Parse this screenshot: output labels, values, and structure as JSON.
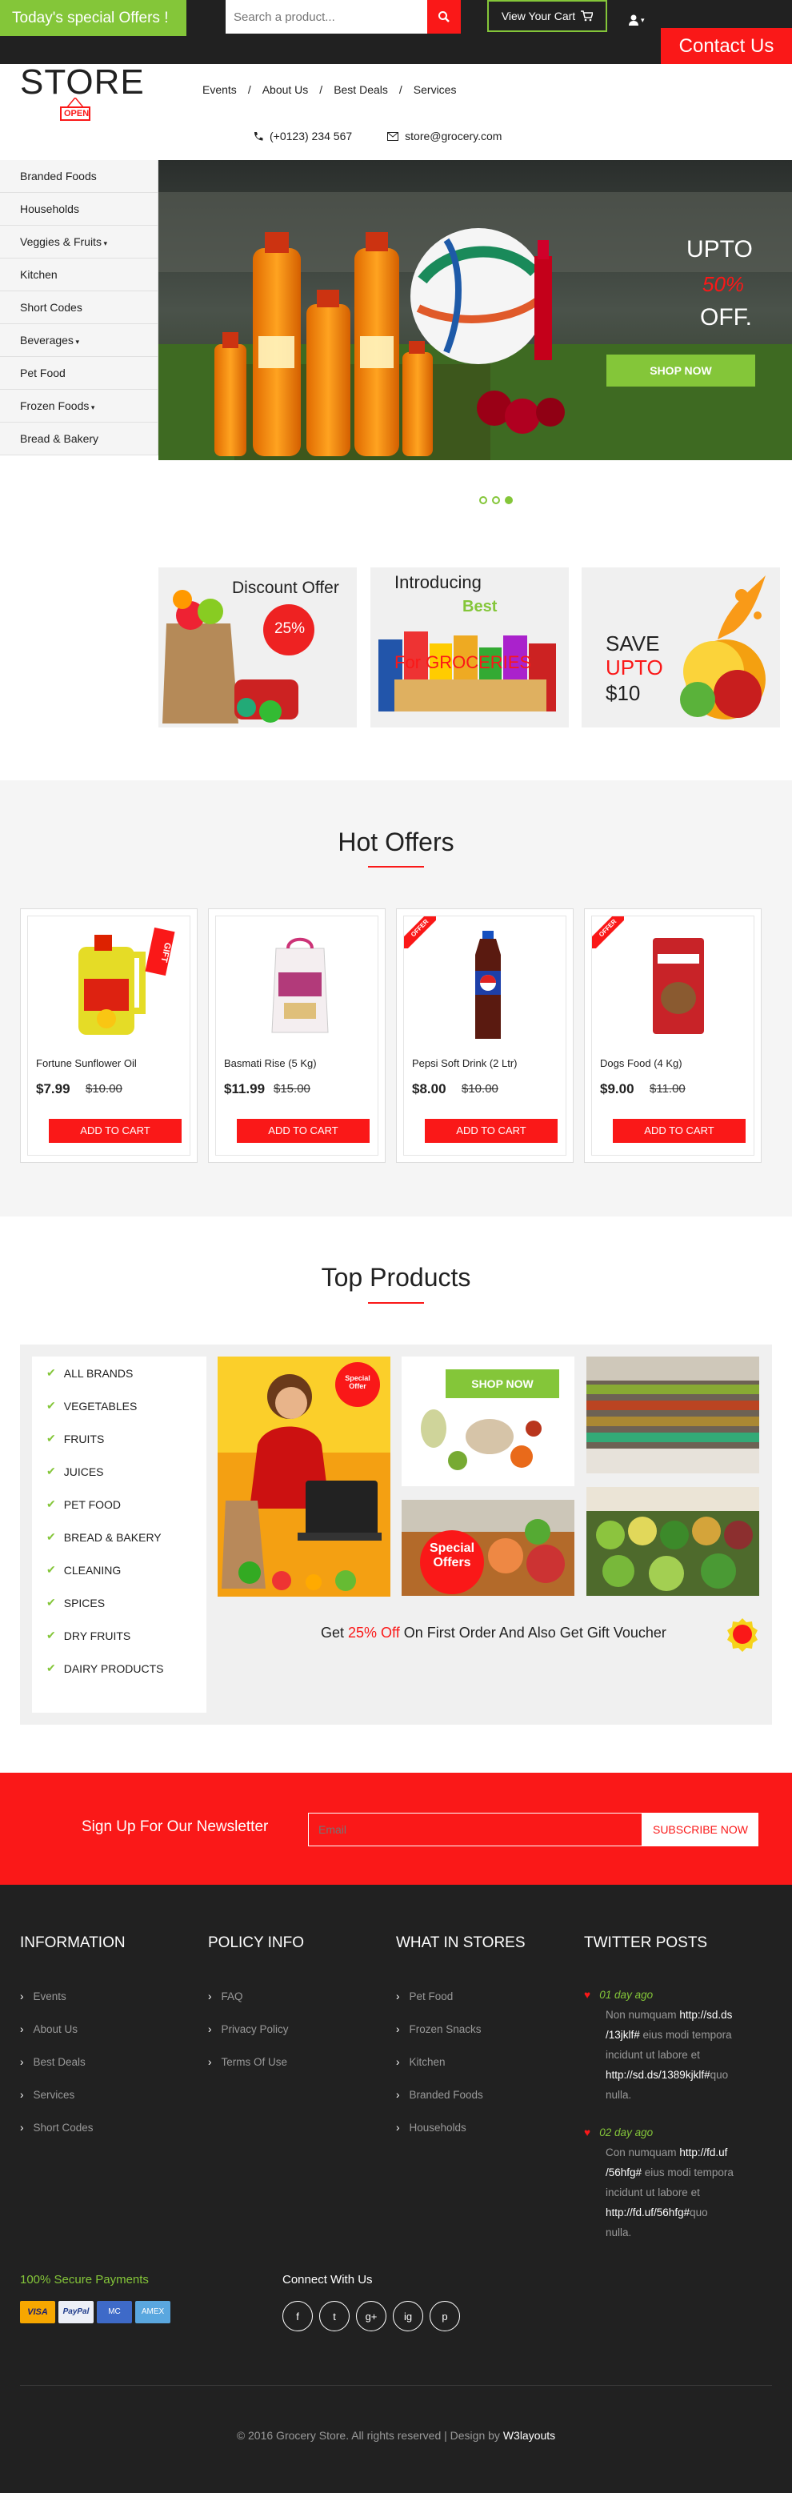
{
  "topbar": {
    "offer_badge": "Today's special Offers !",
    "search_placeholder": "Search a product...",
    "cart_label": "View Your Cart",
    "contact_label": "Contact Us"
  },
  "brand": {
    "logo": "STORE",
    "logo_sign": "OPEN"
  },
  "nav": {
    "items": [
      "Events",
      "About Us",
      "Best Deals",
      "Services"
    ]
  },
  "contact": {
    "phone": "(+0123) 234 567",
    "email": "store@grocery.com"
  },
  "sidebar": {
    "items": [
      "Branded Foods",
      "Households",
      "Veggies & Fruits",
      "Kitchen",
      "Short Codes",
      "Beverages",
      "Pet Food",
      "Frozen Foods",
      "Bread & Bakery"
    ]
  },
  "hero": {
    "line1": "UPTO",
    "line2": "50%",
    "line3": "OFF.",
    "button": "SHOP NOW"
  },
  "promos": [
    {
      "title": "Discount Offer",
      "badge": "25%"
    },
    {
      "title": "Introducing",
      "sub": "Best",
      "overlay": "For GROCERIES"
    },
    {
      "title": "SAVE",
      "sub": "UPTO",
      "amount": "$10"
    }
  ],
  "hot_offers": {
    "title": "Hot Offers",
    "add_label": "ADD TO CART",
    "gift_tag": "GIFT",
    "offer_tag": "OFFER",
    "products": [
      {
        "name": "Fortune Sunflower Oil",
        "price": "$7.99",
        "old": "$10.00"
      },
      {
        "name": "Basmati Rise (5 Kg)",
        "price": "$11.99",
        "old": "$15.00"
      },
      {
        "name": "Pepsi Soft Drink (2 Ltr)",
        "price": "$8.00",
        "old": "$10.00"
      },
      {
        "name": "Dogs Food (4 Kg)",
        "price": "$9.00",
        "old": "$11.00"
      }
    ]
  },
  "top_products": {
    "title": "Top Products",
    "brands": [
      "ALL BRANDS",
      "VEGETABLES",
      "FRUITS",
      "JUICES",
      "PET FOOD",
      "BREAD & BAKERY",
      "CLEANING",
      "SPICES",
      "DRY FRUITS",
      "DAIRY PRODUCTS"
    ],
    "special_offer": "Special Offer",
    "special_offers": "Special Offers",
    "shop_now": "SHOP NOW",
    "voucher_pre": "Get ",
    "voucher_pct": "25% Off",
    "voucher_post": " On First Order And Also Get Gift Voucher"
  },
  "newsletter": {
    "label": "Sign Up For Our Newsletter",
    "placeholder": "Email",
    "button": "SUBSCRIBE NOW"
  },
  "footer": {
    "information": {
      "title": "INFORMATION",
      "links": [
        "Events",
        "About Us",
        "Best Deals",
        "Services",
        "Short Codes"
      ]
    },
    "policy": {
      "title": "POLICY INFO",
      "links": [
        "FAQ",
        "Privacy Policy",
        "Terms Of Use"
      ]
    },
    "stores": {
      "title": "WHAT IN STORES",
      "links": [
        "Pet Food",
        "Frozen Snacks",
        "Kitchen",
        "Branded Foods",
        "Households"
      ]
    },
    "twitter": {
      "title": "TWITTER POSTS",
      "posts": [
        {
          "time": "01 day ago",
          "l1a": "Non numquam ",
          "l1b": "http://sd.ds",
          "l2a": "/13jklf#",
          "l2b": " eius modi tempora",
          "l3": "incidunt ut labore et",
          "l4a": "http://sd.ds/1389kjklf#",
          "l4b": "quo",
          "l5": "nulla."
        },
        {
          "time": "02 day ago",
          "l1a": "Con numquam ",
          "l1b": "http://fd.uf",
          "l2a": "/56hfg#",
          "l2b": " eius modi tempora",
          "l3": "incidunt ut labore et",
          "l4a": "http://fd.uf/56hfg#",
          "l4b": "quo",
          "l5": "nulla."
        }
      ]
    },
    "secure": "100% Secure Payments",
    "payment": [
      "VISA",
      "PayPal",
      "MC",
      "AMEX"
    ],
    "connect": "Connect With Us",
    "social": [
      "f",
      "t",
      "g+",
      "ig",
      "p"
    ],
    "copyright": "© 2016 Grocery Store. All rights reserved | Design by ",
    "designer": "W3layouts"
  },
  "colors": {
    "green": "#84c639",
    "red": "#fa1818",
    "dark": "#212121"
  }
}
